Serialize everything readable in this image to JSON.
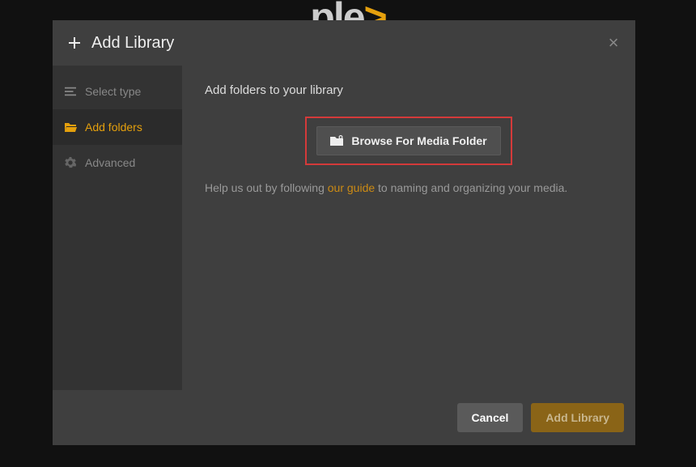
{
  "logo": {
    "text": "ple",
    "chevron": ">"
  },
  "modal": {
    "title": "Add Library",
    "close": "×"
  },
  "sidebar": {
    "items": [
      {
        "label": "Select type"
      },
      {
        "label": "Add folders"
      },
      {
        "label": "Advanced"
      }
    ]
  },
  "content": {
    "heading": "Add folders to your library",
    "browse_button": "Browse For Media Folder",
    "help_prefix": "Help us out by following ",
    "help_link": "our guide",
    "help_suffix": " to naming and organizing your media."
  },
  "footer": {
    "cancel": "Cancel",
    "add": "Add Library"
  }
}
